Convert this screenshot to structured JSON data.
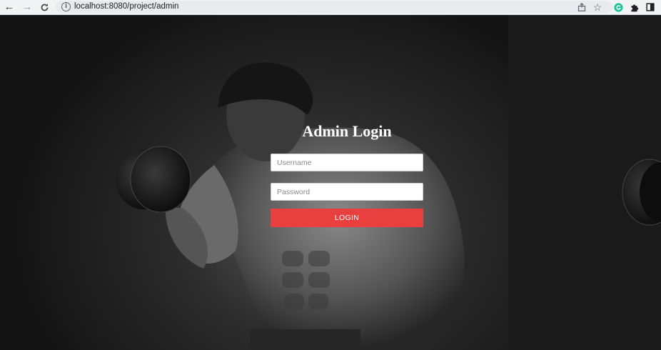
{
  "browser": {
    "url": "localhost:8080/project/admin",
    "icons": [
      "back-icon",
      "forward-icon",
      "reload-icon",
      "info-icon",
      "share-icon",
      "star-icon",
      "grammarly-icon",
      "extensions-icon",
      "side-panel-icon"
    ]
  },
  "login": {
    "title": "Admin Login",
    "username_placeholder": "Username",
    "password_placeholder": "Password",
    "button_label": "LOGIN",
    "button_color": "#e8403f"
  }
}
